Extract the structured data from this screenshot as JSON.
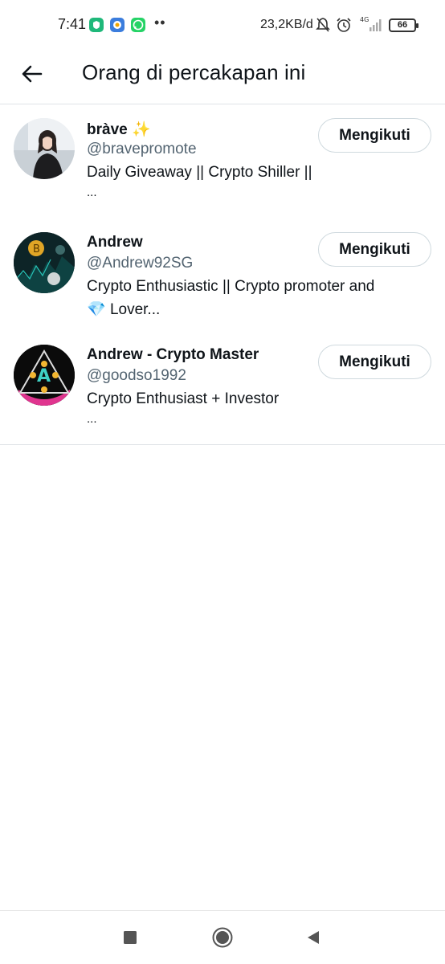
{
  "status_bar": {
    "time": "7:41",
    "network_speed": "23,2KB/d",
    "signal_label": "4G",
    "battery": "66",
    "dots": "••"
  },
  "header": {
    "title": "Orang di percakapan ini",
    "back_icon": "arrow-left-icon"
  },
  "users": [
    {
      "display_name": "bràve",
      "name_emoji": "✨",
      "handle": "@bravepromote",
      "bio_line1": "Daily Giveaway || Crypto Shiller ||",
      "bio_line2": "...",
      "follow_label": "Mengikuti"
    },
    {
      "display_name": "Andrew",
      "handle": "@Andrew92SG",
      "bio_line1": "Crypto Enthusiastic || Crypto promoter and",
      "bio_line2_emoji": "💎",
      "bio_line2": "Lover...",
      "follow_label": "Mengikuti"
    },
    {
      "display_name": "Andrew - Crypto Master",
      "handle": "@goodso1992",
      "bio_line1": "Crypto Enthusiast + Investor",
      "bio_line2": "...",
      "follow_label": "Mengikuti"
    }
  ],
  "nav": {
    "recents_icon": "square-icon",
    "home_icon": "circle-icon",
    "back_icon": "triangle-back-icon"
  },
  "colors": {
    "text_primary": "#0f1419",
    "text_secondary": "#536471",
    "border": "#cfd9de",
    "divider": "#dfe3e6"
  }
}
